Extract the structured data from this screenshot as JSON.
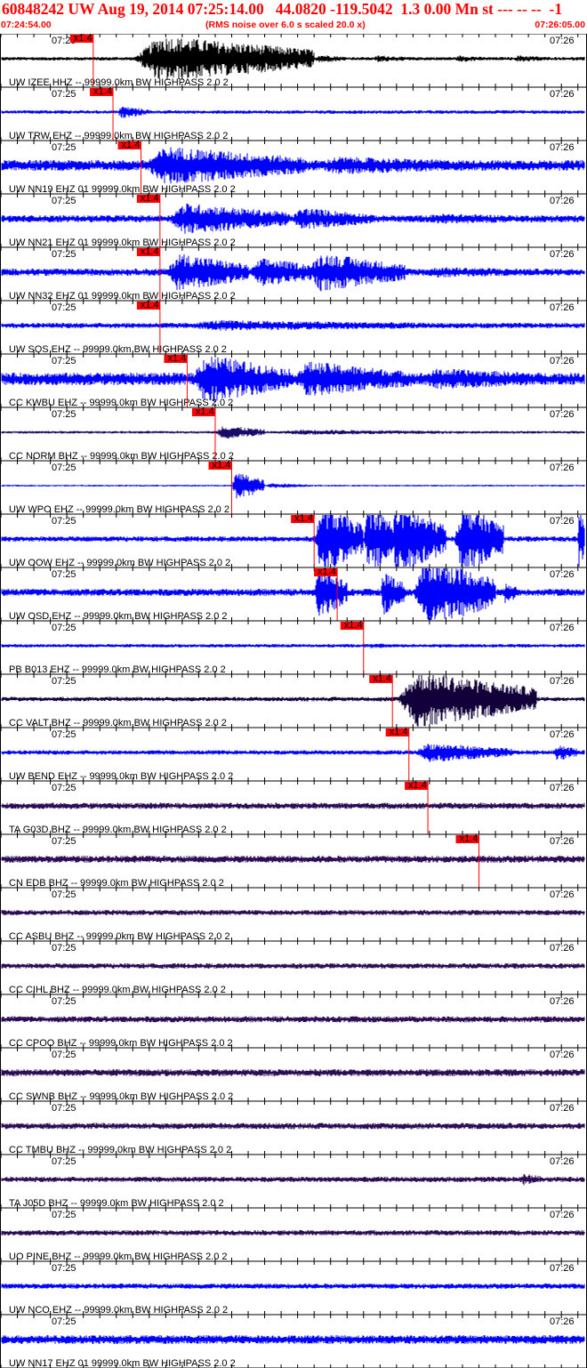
{
  "header": {
    "title": "60848242 UW Aug 19, 2014 07:25:14.00   44.0820 -119.5042  1.3 0.00 Mn st --- -- --  -1",
    "start_time": "07:24:54.00",
    "note": "(RMS noise over 6.0 s scaled 20.0 x)",
    "end_time": "07:26:05.00"
  },
  "colors": {
    "header_red": "#ff0000",
    "pick_red": "#ff0000",
    "trace_black": "#000000",
    "trace_blue": "#0000ff",
    "trace_navy": "#1a0a6a",
    "trace_purple": "#2a0d55",
    "trace_dark": "#12003a"
  },
  "chart_data": {
    "type": "line",
    "title": "60848242 UW Aug 19, 2014 07:25:14.00   44.0820 -119.5042  1.3 0.00 Mn st --- -- --  -1",
    "time_range": [
      "07:24:54.00",
      "07:26:05.00"
    ],
    "time_range_seconds": [
      0,
      71
    ],
    "tick_labels": [
      "07:25",
      "07:26"
    ],
    "tick_label_seconds": [
      6,
      66
    ],
    "minor_tick_interval_s": 2,
    "grid": false,
    "pick_label": "x1.4",
    "traces": [
      {
        "label": "UW IZEE HHZ -- 99999.0km BW  HIGHPASS  2.0  2",
        "color": "#000000",
        "pick_s": 11.2,
        "noise": 2,
        "bursts": [
          [
            16,
            22,
            26
          ],
          [
            25,
            3,
            9
          ],
          [
            32,
            3,
            6
          ],
          [
            38,
            4,
            5
          ],
          [
            45,
            5,
            4
          ],
          [
            55,
            4,
            4
          ],
          [
            62,
            5,
            4
          ]
        ]
      },
      {
        "label": "UW TRW EHZ -- 99999.0km BW  HIGHPASS  2.0  2",
        "color": "#0000ff",
        "pick_s": 13.6,
        "noise": 2,
        "bursts": [
          [
            14,
            4,
            7
          ]
        ]
      },
      {
        "label": "UW NN19 EHZ 01 99999.0km BW  HIGHPASS  2.0  2",
        "color": "#0000ff",
        "pick_s": 17,
        "noise": 6,
        "bursts": [
          [
            17,
            20,
            22
          ],
          [
            37,
            25,
            10
          ]
        ]
      },
      {
        "label": "UW NN21 EHZ 01 99999.0km BW  HIGHPASS  2.0  2",
        "color": "#0000ff",
        "pick_s": 19.3,
        "noise": 4,
        "bursts": [
          [
            20,
            15,
            18
          ],
          [
            35,
            10,
            13
          ],
          [
            50,
            20,
            6
          ]
        ]
      },
      {
        "label": "UW NN32 EHZ 01 99999.0km BW  HIGHPASS  2.0  2",
        "color": "#0000ff",
        "pick_s": 19.3,
        "noise": 4,
        "bursts": [
          [
            20,
            10,
            22
          ],
          [
            30,
            10,
            16
          ],
          [
            37,
            12,
            22
          ],
          [
            50,
            20,
            6
          ]
        ]
      },
      {
        "label": "UW SQS EHZ -- 99999.0km BW  HIGHPASS  2.0  2",
        "color": "#0000ff",
        "pick_s": 19.3,
        "noise": 3,
        "bursts": [
          [
            20,
            40,
            6
          ]
        ]
      },
      {
        "label": "CC KWBU EHZ -- 99999.0km BW  HIGHPASS  2.0  2",
        "color": "#0000ff",
        "pick_s": 22.6,
        "noise": 7,
        "bursts": [
          [
            23,
            12,
            28
          ],
          [
            35,
            15,
            20
          ],
          [
            50,
            20,
            12
          ]
        ]
      },
      {
        "label": "CC NORM BHZ -- 99999.0km BW  HIGHPASS  2.0  2",
        "color": "#1a0a6a",
        "pick_s": 26,
        "noise": 1.5,
        "bursts": [
          [
            26,
            6,
            8
          ],
          [
            32,
            30,
            3
          ]
        ]
      },
      {
        "label": "UW WPO EHZ -- 99999.0km BW  HIGHPASS  2.0  2",
        "color": "#0000ff",
        "pick_s": 28,
        "noise": 1,
        "bursts": [
          [
            28,
            4,
            16
          ],
          [
            32,
            6,
            3
          ]
        ]
      },
      {
        "label": "UW OOW EHZ -- 99999.0km BW  HIGHPASS  2.0  2",
        "color": "#0000ff",
        "pick_s": 38,
        "noise": 3,
        "bursts": [
          [
            38,
            6,
            40
          ],
          [
            44,
            4,
            40
          ],
          [
            47,
            7,
            40
          ],
          [
            55,
            6,
            40
          ],
          [
            70,
            1,
            40
          ]
        ]
      },
      {
        "label": "UW OSD EHZ -- 99999.0km BW  HIGHPASS  2.0  2",
        "color": "#0000ff",
        "pick_s": 40.8,
        "noise": 4,
        "bursts": [
          [
            38,
            4,
            30
          ],
          [
            46,
            3,
            25
          ],
          [
            50,
            10,
            40
          ],
          [
            61,
            1.5,
            15
          ]
        ]
      },
      {
        "label": "PB B013 EHZ -- 99999.0km BW  HIGHPASS  2.0  2",
        "color": "#0000ff",
        "pick_s": 44,
        "noise": 2,
        "bursts": [
          [
            44,
            6,
            3
          ]
        ]
      },
      {
        "label": "CC VALT BHZ -- 99999.0km BW  HIGHPASS  2.0  2",
        "color": "#12003a",
        "pick_s": 47.5,
        "noise": 2.5,
        "bursts": [
          [
            48,
            17,
            32
          ]
        ]
      },
      {
        "label": "UW BEND EHZ -- 99999.0km BW  HIGHPASS  2.0  2",
        "color": "#0000ff",
        "pick_s": 49.5,
        "noise": 2.5,
        "bursts": [
          [
            50,
            12,
            11
          ],
          [
            67,
            3,
            10
          ]
        ]
      },
      {
        "label": "TA G03D BHZ -- 99999.0km BW  HIGHPASS  2.0  2",
        "color": "#2a0d55",
        "pick_s": 51.8,
        "noise": 3.5,
        "bursts": []
      },
      {
        "label": "CN EDB BHZ -- 99999.0km BW  HIGHPASS  2.0  2",
        "color": "#2a0d55",
        "pick_s": 58,
        "noise": 4,
        "bursts": []
      },
      {
        "label": "CC ASBU BHZ -- 99999.0km BW  HIGHPASS  2.0  2",
        "color": "#2a0d55",
        "pick_s": null,
        "noise": 3,
        "bursts": []
      },
      {
        "label": "CC CIHL BHZ -- 99999.0km BW  HIGHPASS  2.0  2",
        "color": "#2a0d55",
        "pick_s": null,
        "noise": 3,
        "bursts": []
      },
      {
        "label": "CC CPOO BHZ -- 99999.0km BW  HIGHPASS  2.0  2",
        "color": "#2a0d55",
        "pick_s": null,
        "noise": 3.5,
        "bursts": []
      },
      {
        "label": "CC SWNB BHZ -- 99999.0km BW  HIGHPASS  2.0  2",
        "color": "#2a0d55",
        "pick_s": null,
        "noise": 4,
        "bursts": []
      },
      {
        "label": "CC TMBU BHZ -- 99999.0km BW  HIGHPASS  2.0  2",
        "color": "#2a0d55",
        "pick_s": null,
        "noise": 3.5,
        "bursts": []
      },
      {
        "label": "TA J05D BHZ -- 99999.0km BW  HIGHPASS  2.0  2",
        "color": "#2a0d55",
        "pick_s": null,
        "noise": 3,
        "bursts": [
          [
            63,
            3,
            7
          ]
        ]
      },
      {
        "label": "UO PINE BHZ -- 99999.0km BW  HIGHPASS  2.0  2",
        "color": "#2a0d55",
        "pick_s": null,
        "noise": 3,
        "bursts": []
      },
      {
        "label": "UW NCO EHZ -- 99999.0km BW  HIGHPASS  2.0  2",
        "color": "#0000ff",
        "pick_s": null,
        "noise": 3,
        "bursts": []
      },
      {
        "label": "UW NN17 EHZ 01 99999.0km BW  HIGHPASS  2.0  2",
        "color": "#0000ff",
        "pick_s": null,
        "noise": 5,
        "bursts": []
      }
    ]
  }
}
